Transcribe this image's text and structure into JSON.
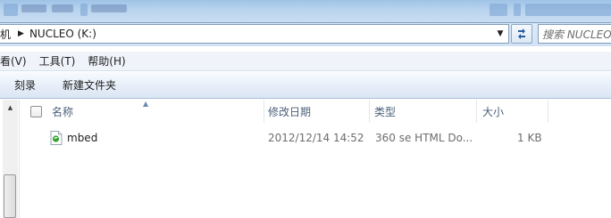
{
  "address": {
    "crumbs": [
      "机",
      "NUCLEO (K:)"
    ],
    "search_placeholder": "搜索 NUCLEO"
  },
  "menubar": {
    "items": [
      "看(V)",
      "工具(T)",
      "帮助(H)"
    ]
  },
  "commandbar": {
    "burn_label": "刻录",
    "new_folder_label": "新建文件夹"
  },
  "columns": {
    "name": "名称",
    "modified": "修改日期",
    "type": "类型",
    "size": "大小"
  },
  "files": [
    {
      "name": "mbed",
      "modified": "2012/12/14 14:52",
      "type": "360 se HTML Do...",
      "size": "1 KB",
      "icon": "html-document-icon"
    }
  ],
  "colors": {
    "header_text": "#4c607a",
    "row_detail_text": "#6d6d6d",
    "file_icon_accent": "#2fa52f"
  }
}
